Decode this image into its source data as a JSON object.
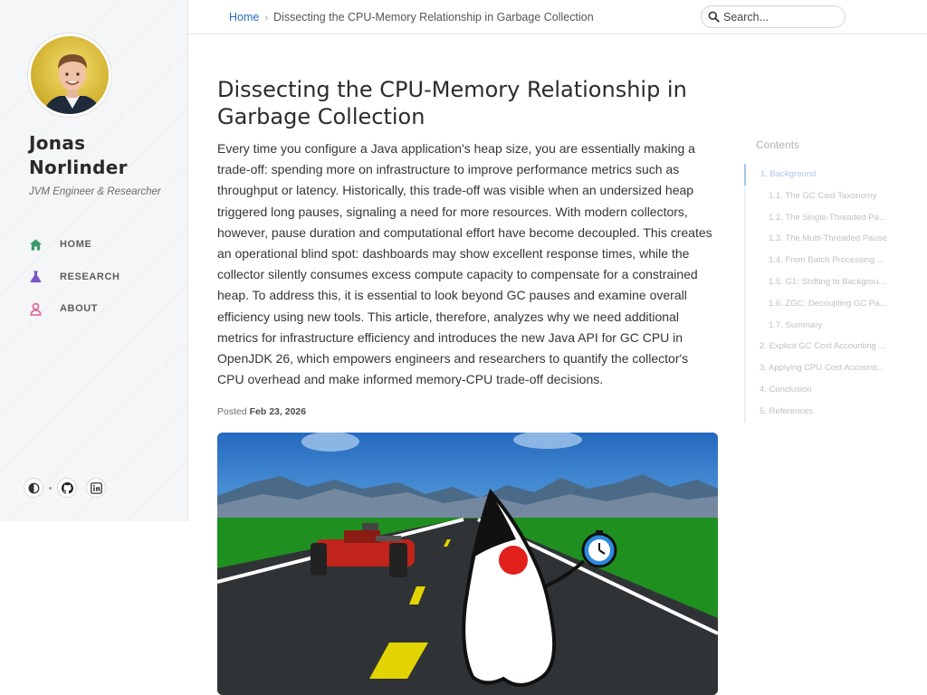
{
  "sidebar": {
    "name_line1": "Jonas",
    "name_line2": "Norlinder",
    "subtitle": "JVM Engineer & Researcher",
    "nav": [
      {
        "label": "HOME",
        "icon": "home-icon",
        "color": "#3a9a6a"
      },
      {
        "label": "RESEARCH",
        "icon": "flask-icon",
        "color": "#7a55c8"
      },
      {
        "label": "ABOUT",
        "icon": "user-icon",
        "color": "#e0689a"
      }
    ],
    "bottom_icons": [
      "theme-toggle-icon",
      "github-icon",
      "linkedin-icon"
    ]
  },
  "topbar": {
    "breadcrumb_home": "Home",
    "breadcrumb_separator": "›",
    "breadcrumb_current": "Dissecting the CPU-Memory Relationship in Garbage Collection",
    "search_placeholder": "Search..."
  },
  "post": {
    "title": "Dissecting the CPU-Memory Relationship in Garbage Collection",
    "body": "Every time you configure a Java application's heap size, you are essentially making a trade-off: spending more on infrastructure to improve performance metrics such as throughput or latency. Historically, this trade-off was visible when an undersized heap triggered long pauses, signaling a need for more resources. With modern collectors, however, pause duration and computational effort have become decoupled. This creates an operational blind spot: dashboards may show excellent response times, while the collector silently consumes excess compute capacity to compensate for a constrained heap. To address this, it is essential to look beyond GC pauses and examine overall efficiency using new tools. This article, therefore, analyzes why we need additional metrics for infrastructure efficiency and introduces the new Java API for GC CPU in OpenJDK 26, which empowers engineers and researchers to quantify the collector's CPU overhead and make informed memory-CPU trade-off decisions.",
    "posted_label": "Posted",
    "posted_date": "Feb 23, 2026"
  },
  "toc": {
    "title": "Contents",
    "items": [
      {
        "label": "1. Background",
        "level": 1,
        "active": true
      },
      {
        "label": "1.1. The GC Cost Taxonomy",
        "level": 2
      },
      {
        "label": "1.2. The Single-Threaded Pa...",
        "level": 2
      },
      {
        "label": "1.3. The Multi-Threaded Pause",
        "level": 2
      },
      {
        "label": "1.4. From Batch Processing ...",
        "level": 2
      },
      {
        "label": "1.5. G1: Shifting to Backgrou...",
        "level": 2
      },
      {
        "label": "1.6. ZGC: Decoupling GC Pa...",
        "level": 2
      },
      {
        "label": "1.7. Summary",
        "level": 2
      },
      {
        "label": "2. Explicit GC Cost Accounting ...",
        "level": 1
      },
      {
        "label": "3. Applying CPU Cost Accounti...",
        "level": 1
      },
      {
        "label": "4. Conclusion",
        "level": 1
      },
      {
        "label": "5. References",
        "level": 1
      }
    ]
  },
  "colors": {
    "link": "#2a6db7",
    "toc_active": "#a6c6e8",
    "sidebar_bg": "#f5f6f8"
  }
}
